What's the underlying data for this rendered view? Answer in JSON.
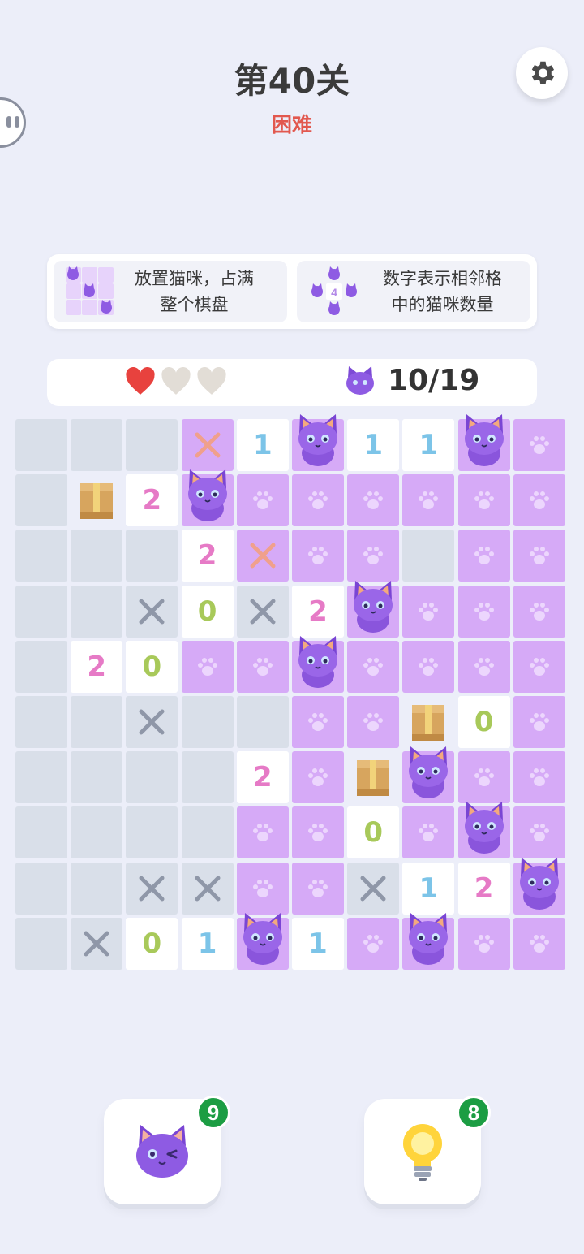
{
  "header": {
    "title": "第40关",
    "difficulty": "困难"
  },
  "rules": [
    {
      "text_line1": "放置猫咪，占满",
      "text_line2": "整个棋盘"
    },
    {
      "text_line1": "数字表示相邻格",
      "text_line2": "中的猫咪数量",
      "example_number": "4"
    }
  ],
  "status": {
    "lives_total": 3,
    "lives_remaining": 1,
    "cats_count": "10/19"
  },
  "colors": {
    "accent_title": "#3b3b3b",
    "difficulty": "#e2584f",
    "paw_cell": "#d6aaf7",
    "empty_cell": "#d9dfe9",
    "number_cell": "#ffffff",
    "cat": "#8e5be3",
    "badge": "#1c9d43",
    "num_1": "#7cc4e8",
    "num_2": "#e67ac6",
    "num_0": "#a8c95a"
  },
  "board": {
    "rows": 10,
    "cols": 10,
    "cells": [
      [
        "E",
        "E",
        "E",
        "XR",
        "1",
        "C",
        "1",
        "1",
        "C",
        "P"
      ],
      [
        "E",
        "B",
        "2",
        "C",
        "P",
        "P",
        "P",
        "P",
        "P",
        "P"
      ],
      [
        "E",
        "E",
        "E",
        "2",
        "XR",
        "P",
        "P",
        "E",
        "P",
        "P"
      ],
      [
        "E",
        "E",
        "X",
        "0",
        "X",
        "2",
        "C",
        "P",
        "P",
        "P"
      ],
      [
        "E",
        "2",
        "0",
        "P",
        "P",
        "C",
        "P",
        "P",
        "P",
        "P"
      ],
      [
        "E",
        "E",
        "X",
        "E",
        "E",
        "P",
        "P",
        "B",
        "0",
        "P"
      ],
      [
        "E",
        "E",
        "E",
        "E",
        "2",
        "P",
        "B",
        "C",
        "P",
        "P"
      ],
      [
        "E",
        "E",
        "E",
        "E",
        "P",
        "P",
        "0",
        "P",
        "C",
        "P"
      ],
      [
        "E",
        "E",
        "X",
        "X",
        "P",
        "P",
        "X",
        "1",
        "2",
        "C"
      ],
      [
        "E",
        "X",
        "0",
        "1",
        "C",
        "1",
        "P",
        "C",
        "P",
        "P"
      ]
    ]
  },
  "bottom": {
    "cat_button": {
      "icon": "cat-wink-icon",
      "badge": "9"
    },
    "hint_button": {
      "icon": "lightbulb-icon",
      "badge": "8"
    }
  }
}
